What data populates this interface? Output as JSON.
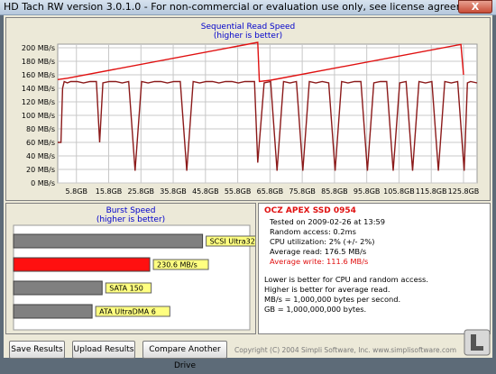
{
  "window": {
    "title": "HD Tach RW version 3.0.1.0  - For non-commercial or evaluation use only, see license agreement.",
    "close_glyph": "X"
  },
  "chart_data": [
    {
      "type": "line",
      "title": "Sequential Read Speed",
      "subtitle": "(higher is better)",
      "ylim": [
        0,
        200
      ],
      "y_ticks": [
        "0 MB/s",
        "20 MB/s",
        "40 MB/s",
        "60 MB/s",
        "80 MB/s",
        "100 MB/s",
        "120 MB/s",
        "140 MB/s",
        "160 MB/s",
        "180 MB/s",
        "200 MB/s"
      ],
      "x_ticks": [
        "5.8GB",
        "15.8GB",
        "25.8GB",
        "35.8GB",
        "45.8GB",
        "55.8GB",
        "65.8GB",
        "75.8GB",
        "85.8GB",
        "95.8GB",
        "105.8GB",
        "115.8GB",
        "125.8GB"
      ],
      "grid": true,
      "series": [
        {
          "color": "#8b1a1a",
          "x": [
            0,
            1,
            1.5,
            2,
            3,
            4,
            6,
            8,
            10,
            12,
            13,
            14,
            16,
            18,
            20,
            22,
            24,
            26,
            28,
            30,
            32,
            34,
            36,
            38,
            40,
            42,
            44,
            46,
            48,
            50,
            52,
            54,
            56,
            58,
            60,
            61,
            62,
            64,
            66,
            68,
            70,
            72,
            74,
            76,
            78,
            80,
            82,
            84,
            86,
            88,
            90,
            92,
            94,
            96,
            98,
            100,
            102,
            104,
            106,
            108,
            110,
            112,
            114,
            116,
            118,
            120,
            122,
            124,
            126,
            127,
            128,
            130
          ],
          "y": [
            60,
            60,
            140,
            150,
            148,
            150,
            150,
            148,
            150,
            150,
            60,
            148,
            150,
            150,
            148,
            150,
            18,
            150,
            148,
            150,
            150,
            148,
            150,
            150,
            18,
            150,
            148,
            150,
            150,
            148,
            150,
            150,
            148,
            150,
            150,
            150,
            30,
            148,
            150,
            18,
            150,
            148,
            150,
            18,
            150,
            148,
            150,
            148,
            18,
            150,
            148,
            150,
            150,
            18,
            148,
            150,
            150,
            18,
            148,
            150,
            18,
            150,
            148,
            150,
            18,
            150,
            148,
            150,
            18,
            148,
            150,
            148
          ]
        },
        {
          "color": "#e01010",
          "x": [
            0,
            3,
            62,
            62.5,
            66,
            125,
            125.8
          ],
          "y": [
            153,
            155,
            208,
            150,
            152,
            205,
            160
          ]
        }
      ]
    },
    {
      "type": "bar",
      "title": "Burst Speed",
      "subtitle": "(higher is better)",
      "categories": [
        "SCSI Ultra320",
        "230.6 MB/s",
        "SATA 150",
        "ATA UltraDMA 6"
      ],
      "values": [
        320,
        230.6,
        150,
        133
      ],
      "colors": [
        "#808080",
        "#ff1010",
        "#808080",
        "#808080"
      ],
      "xlim": [
        0,
        400
      ]
    }
  ],
  "info": {
    "drive_name": "OCZ APEX SSD 0954",
    "tested_on": "Tested on 2009-02-26 at 13:59",
    "random_access": "Random access: 0.2ms",
    "cpu": "CPU utilization: 2% (+/- 2%)",
    "avg_read": "Average read: 176.5 MB/s",
    "avg_write": "Average write: 111.6 MB/s",
    "notes": [
      "Lower is better for CPU and random access.",
      "Higher is better for average read.",
      "MB/s = 1,000,000 bytes per second.",
      "GB = 1,000,000,000 bytes."
    ],
    "accent_red": "#e01010"
  },
  "buttons": {
    "save": "Save Results",
    "upload": "Upload Results",
    "compare": "Compare Another Drive"
  },
  "copyright": "Copyright (C) 2004 Simpli Software, Inc. www.simplisoftware.com",
  "logo_text": "Legit Reviews"
}
